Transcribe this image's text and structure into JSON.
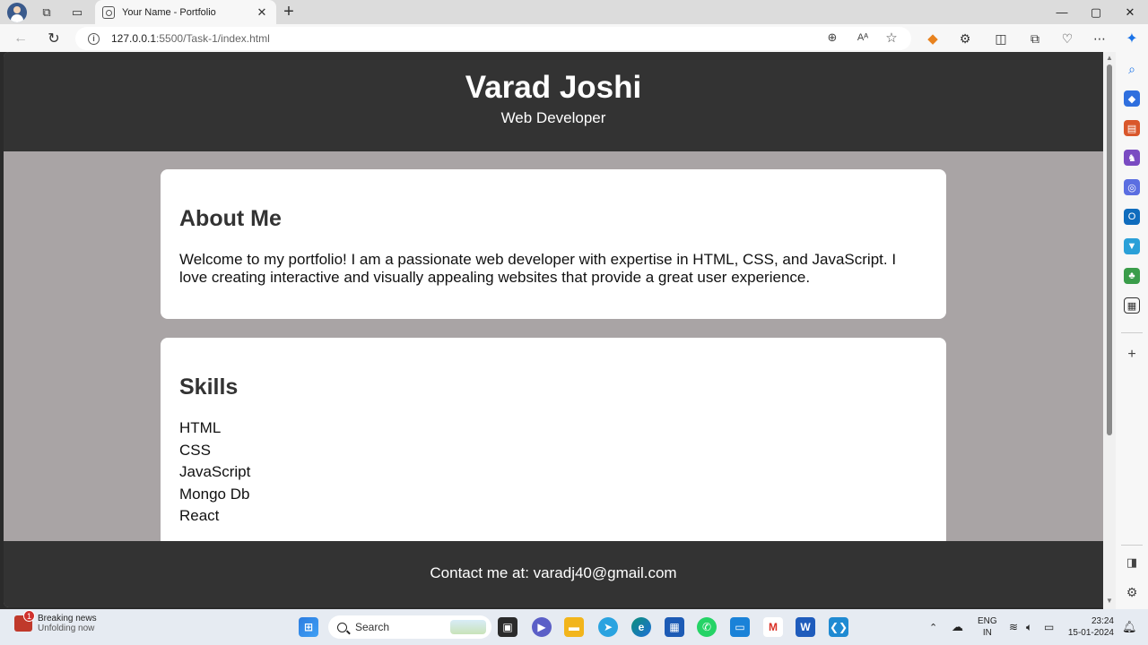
{
  "browser": {
    "tab_title": "Your Name - Portfolio",
    "tab_close": "✕",
    "new_tab": "+",
    "url_host": "127.0.0.1",
    "url_path": ":5500/Task-1/index.html",
    "window_controls": {
      "minimize": "—",
      "maximize": "▢",
      "close": "✕"
    }
  },
  "page": {
    "header": {
      "name": "Varad Joshi",
      "role": "Web Developer"
    },
    "about": {
      "heading": "About Me",
      "text": "Welcome to my portfolio! I am a passionate web developer with expertise in HTML, CSS, and JavaScript. I love creating interactive and visually appealing websites that provide a great user experience."
    },
    "skills": {
      "heading": "Skills",
      "items": [
        "HTML",
        "CSS",
        "JavaScript",
        "Mongo Db",
        "React"
      ]
    },
    "footer": {
      "contact": "Contact me at: varadj40@gmail.com"
    }
  },
  "taskbar": {
    "news_title": "Breaking news",
    "news_subtitle": "Unfolding now",
    "news_badge": "1",
    "search_label": "Search",
    "language": "ENG",
    "region": "IN",
    "time": "23:24",
    "date": "15-01-2024"
  },
  "colors": {
    "page_background": "#a9a4a5",
    "header_footer": "#333333",
    "card": "#ffffff"
  }
}
